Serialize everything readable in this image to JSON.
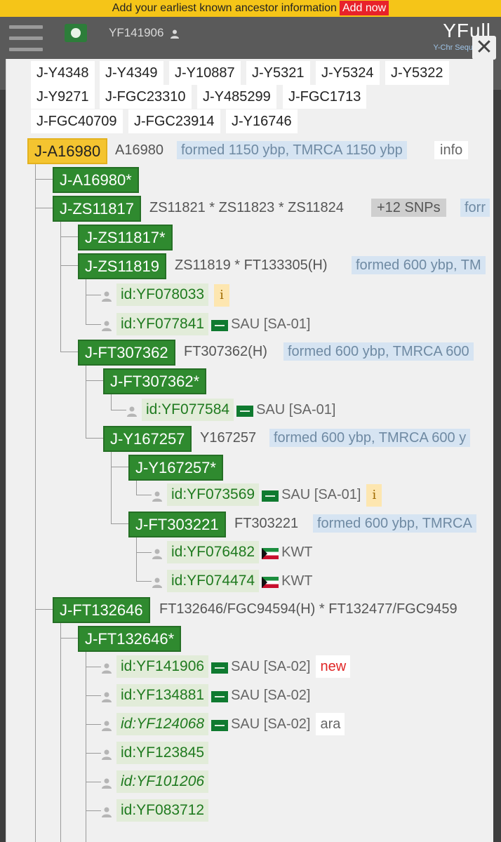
{
  "banner": {
    "text": "Add your earliest known ancestor information",
    "link": "Add now"
  },
  "header": {
    "user_id": "YF141906",
    "brand": "YFull",
    "brand_sub": "Y-Chr Sequ"
  },
  "chips": [
    "J-Y4348",
    "J-Y4349",
    "J-Y10887",
    "J-Y5321",
    "J-Y5324",
    "J-Y5322",
    "J-Y9271",
    "J-FGC23310",
    "J-Y485299",
    "J-FGC1713",
    "J-FGC40709",
    "J-FGC23914",
    "J-Y16746"
  ],
  "tree": {
    "root": {
      "label": "J-A16980",
      "snps": "A16980",
      "formed": "formed 1150 ybp, TMRCA 1150 ybp",
      "info": "info"
    },
    "a16980star": {
      "label": "J-A16980*"
    },
    "zs11817": {
      "label": "J-ZS11817",
      "snps": "ZS11821 * ZS11823 * ZS11824",
      "more": "+12 SNPs",
      "formed": "forr"
    },
    "zs11817star": {
      "label": "J-ZS11817*"
    },
    "zs11819": {
      "label": "J-ZS11819",
      "snps": "ZS11819 * FT133305(H)",
      "formed": "formed 600 ybp, TM"
    },
    "ft307362": {
      "label": "J-FT307362",
      "snps": "FT307362(H)",
      "formed": "formed 600 ybp, TMRCA 600"
    },
    "ft307362star": {
      "label": "J-FT307362*"
    },
    "y167257": {
      "label": "J-Y167257",
      "snps": "Y167257",
      "formed": "formed 600 ybp, TMRCA 600 y"
    },
    "y167257star": {
      "label": "J-Y167257*"
    },
    "ft303221": {
      "label": "J-FT303221",
      "snps": "FT303221",
      "formed": "formed 600 ybp, TMRCA"
    },
    "ft132646": {
      "label": "J-FT132646",
      "snps": "FT132646/FGC94594(H) * FT132477/FGC9459"
    },
    "ft132646star": {
      "label": "J-FT132646*"
    }
  },
  "kits": {
    "k1": {
      "id": "id:YF078033",
      "badge": "i"
    },
    "k2": {
      "id": "id:YF077841",
      "country": "SAU [SA-01]"
    },
    "k3": {
      "id": "id:YF077584",
      "country": "SAU [SA-01]"
    },
    "k4": {
      "id": "id:YF073569",
      "country": "SAU [SA-01]",
      "badge": "i"
    },
    "k5": {
      "id": "id:YF076482",
      "country": "KWT"
    },
    "k6": {
      "id": "id:YF074474",
      "country": "KWT"
    },
    "k7": {
      "id": "id:YF141906",
      "country": "SAU [SA-02]",
      "badge": "new"
    },
    "k8": {
      "id": "id:YF134881",
      "country": "SAU [SA-02]"
    },
    "k9": {
      "id": "id:YF124068",
      "country": "SAU [SA-02]",
      "badge": "ara"
    },
    "k10": {
      "id": "id:YF123845"
    },
    "k11": {
      "id": "id:YF101206"
    },
    "k12": {
      "id": "id:YF083712"
    }
  },
  "icons": {
    "menu": "hamburger-icon",
    "person": "person-icon",
    "close": "close-icon"
  },
  "colors": {
    "banner": "#f5c518",
    "node": "#2f8a2f",
    "root": "#f4c430",
    "formed_bg": "#d6e4f2",
    "new": "#e02424"
  }
}
